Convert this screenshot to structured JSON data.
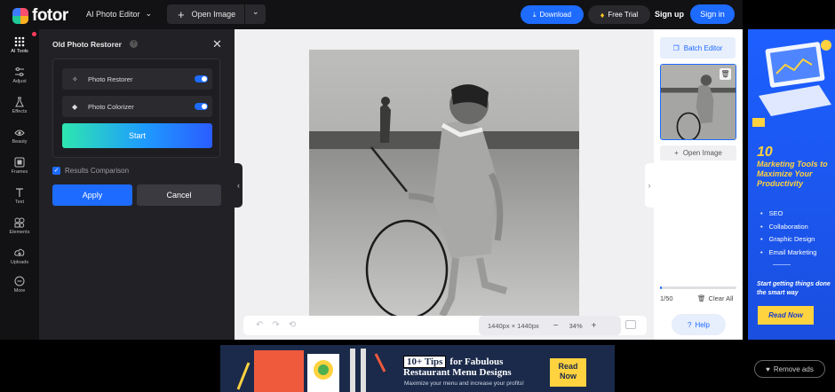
{
  "header": {
    "logo_text": "fotor",
    "product_menu": "AI Photo Editor",
    "open_image": "Open Image",
    "download": "Download",
    "free_trial": "Free Trial",
    "sign_up": "Sign up",
    "sign_in": "Sign in",
    "accent_color": "#1d6bff"
  },
  "sidebar": {
    "items": [
      {
        "label": "AI Tools",
        "icon": "grid-icon",
        "active": true
      },
      {
        "label": "Adjust",
        "icon": "sliders-icon"
      },
      {
        "label": "Effects",
        "icon": "flask-icon"
      },
      {
        "label": "Beauty",
        "icon": "eye-icon"
      },
      {
        "label": "Frames",
        "icon": "frame-icon"
      },
      {
        "label": "Text",
        "icon": "text-icon"
      },
      {
        "label": "Elements",
        "icon": "shapes-icon"
      },
      {
        "label": "Uploads",
        "icon": "cloud-upload-icon"
      },
      {
        "label": "More",
        "icon": "more-icon"
      }
    ]
  },
  "panel": {
    "title": "Old Photo Restorer",
    "features": [
      {
        "label": "Photo Restorer",
        "enabled": true
      },
      {
        "label": "Photo Colorizer",
        "enabled": true
      }
    ],
    "start_label": "Start",
    "comparison_label": "Results Comparison",
    "comparison_checked": true,
    "apply_label": "Apply",
    "cancel_label": "Cancel"
  },
  "canvas": {
    "dimensions": "1440px × 1440px",
    "zoom": "34%"
  },
  "right_panel": {
    "batch_editor": "Batch Editor",
    "open_image": "Open Image",
    "count": "1/50",
    "progress_fraction": 0.02,
    "clear_all": "Clear All",
    "help": "Help"
  },
  "side_ad": {
    "number": "10",
    "title": "Marketing Tools to Maximize Your Productivity",
    "bullets": [
      "SEO",
      "Collaboration",
      "Graphic Design",
      "Email Marketing"
    ],
    "tagline": "Start getting things done the smart way",
    "cta": "Read Now"
  },
  "bottom_ad": {
    "tips_badge": "10+ Tips",
    "headline_1": "for Fabulous",
    "headline_2": "Restaurant Menu Designs",
    "subline": "Maximize your menu and increase your profits!",
    "cta": "Read Now"
  },
  "remove_ads": "Remove ads"
}
